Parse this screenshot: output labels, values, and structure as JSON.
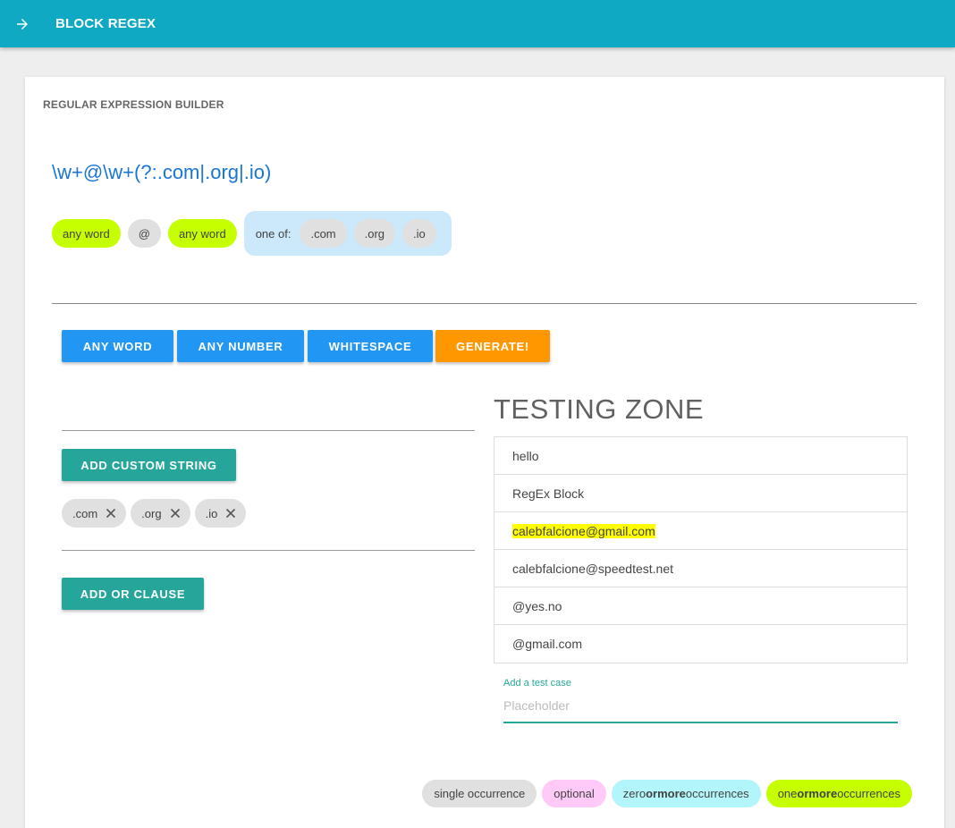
{
  "appbar": {
    "title": "BLOCK REGEX",
    "back_icon": "arrow-forward-icon"
  },
  "builder": {
    "title": "REGULAR EXPRESSION BUILDER",
    "regex": "\\w+@\\w+(?:.com|.org|.io)",
    "blocks": [
      {
        "label": "any word",
        "type": "one or more"
      },
      {
        "label": "@",
        "type": "single"
      },
      {
        "label": "any word",
        "type": "one or more"
      }
    ],
    "or_group": {
      "label": "one of:",
      "options": [
        ".com",
        ".org",
        ".io"
      ]
    }
  },
  "toolbar": {
    "any_word": "ANY WORD",
    "any_number": "ANY NUMBER",
    "whitespace": "WHITESPACE",
    "generate": "GENERATE!"
  },
  "custom": {
    "add_custom_string": "ADD CUSTOM STRING",
    "strings": [
      ".com",
      ".org",
      ".io"
    ],
    "add_or_clause": "ADD OR CLAUSE"
  },
  "testing": {
    "title": "TESTING ZONE",
    "cases": [
      "hello",
      "RegEx Block",
      "calebfalcione@gmail.com",
      "calebfalcione@speedtest.net",
      "@yes.no",
      "@gmail.com"
    ],
    "input_label": "Add a test case",
    "input_placeholder": "Placeholder"
  },
  "legend": {
    "single": "single occurrence",
    "optional": "optional",
    "zero_a": "zero ",
    "zero_or": "or",
    "zero_more": " more",
    "zero_b": " occurrences",
    "one_a": "one ",
    "one_or": "or",
    "one_more": " more",
    "one_b": " occurrences"
  },
  "colors": {
    "appbar": "#0fa9c4",
    "regex_text": "#1976d2",
    "one_or_more": "#c6ff00",
    "zero_or_more": "#b2f5fb",
    "optional": "#ffc9f8",
    "single": "#e0e0e0",
    "or_group": "#cbe9fb",
    "blue_button": "#2196f3",
    "generate_button": "#ff9800",
    "teal_button": "#26a69a",
    "highlight": "#ffff00"
  }
}
